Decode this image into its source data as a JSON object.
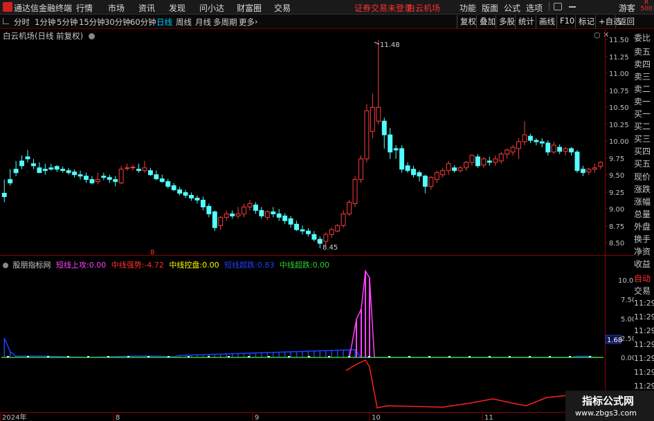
{
  "menubar": {
    "app_title": "通达信金融终端",
    "items": [
      "行情",
      "市场",
      "资讯",
      "发现",
      "问小达",
      "财富圈",
      "交易"
    ],
    "broker_status": "证券交易未登录",
    "stock_name": "白云机场",
    "right_items": [
      "功能",
      "版面",
      "公式",
      "选项"
    ],
    "guest": "游客",
    "badge_top": "R",
    "badge_bottom": "500"
  },
  "toolbar": {
    "periods": [
      "分时",
      "1分钟",
      "5分钟",
      "15分钟",
      "30分钟",
      "60分钟",
      "日线",
      "周线",
      "月线",
      "多周期",
      "更多"
    ],
    "active_period": "日线",
    "right_buttons": [
      "复权",
      "叠加",
      "多股",
      "统计",
      "画线",
      "F10",
      "标记",
      "+自选",
      "返回"
    ]
  },
  "main_chart": {
    "title": "白云机场(日线 前复权)",
    "high_label": "11.48",
    "low_label": "8.45",
    "y_ticks": [
      "11.50",
      "11.25",
      "11.00",
      "10.75",
      "10.50",
      "10.25",
      "10.00",
      "9.75",
      "9.50",
      "9.25",
      "9.00",
      "8.75",
      "8.50"
    ],
    "x_labels": [
      "2024年",
      "8",
      "9",
      "10",
      "11"
    ],
    "marker": "8"
  },
  "indicator": {
    "name": "股朋指标网",
    "fields": [
      {
        "label": "短线上攻:",
        "value": "0.00",
        "color": "#ff40ff"
      },
      {
        "label": "中线强势:",
        "value": "-4.72",
        "color": "#ff3030"
      },
      {
        "label": "中线控盘:",
        "value": "0.00",
        "color": "#ffff00"
      },
      {
        "label": "短线超跌:",
        "value": "0.83",
        "color": "#2040ff"
      },
      {
        "label": "中线超跌:",
        "value": "0.00",
        "color": "#30d030"
      }
    ],
    "y_ticks": [
      "10.00",
      "7.50",
      "5.00",
      "2.50",
      "0.00"
    ],
    "current_value": "1.68"
  },
  "sidebar": {
    "items": [
      "委比",
      "卖五",
      "卖四",
      "卖三",
      "卖二",
      "卖一",
      "买一",
      "买二",
      "买三",
      "买四",
      "买五",
      "现价",
      "涨跌",
      "涨幅",
      "总量",
      "外盘",
      "换手",
      "净资",
      "收益"
    ],
    "auto": "自动",
    "trade": "交易",
    "times": [
      "11:29",
      "11:29",
      "11:29",
      "11:29",
      "11:29",
      "11:29",
      "11:29",
      "11:29",
      "11:29",
      "11:29",
      "11:29"
    ]
  },
  "watermark": {
    "line1": "指标公式网",
    "line2": "www.zbgs3.com"
  },
  "chart_data": {
    "type": "candlestick",
    "price_range": [
      8.35,
      11.65
    ],
    "candles": [
      [
        9.25,
        9.45,
        9.2,
        9.12
      ],
      [
        9.45,
        9.6,
        9.4,
        9.36
      ],
      [
        9.6,
        9.72,
        9.55,
        9.5
      ],
      [
        9.72,
        9.8,
        9.65,
        9.6
      ],
      [
        9.78,
        9.88,
        9.75,
        9.7
      ],
      [
        9.68,
        9.75,
        9.65,
        9.6
      ],
      [
        9.62,
        9.7,
        9.55,
        9.55
      ],
      [
        9.6,
        9.68,
        9.58,
        9.52
      ],
      [
        9.62,
        9.68,
        9.6,
        9.58
      ],
      [
        9.64,
        9.66,
        9.6,
        9.56
      ],
      [
        9.6,
        9.64,
        9.58,
        9.55
      ],
      [
        9.58,
        9.62,
        9.55,
        9.52
      ],
      [
        9.56,
        9.6,
        9.52,
        9.48
      ],
      [
        9.52,
        9.58,
        9.5,
        9.45
      ],
      [
        9.5,
        9.55,
        9.45,
        9.4
      ],
      [
        9.45,
        9.5,
        9.4,
        9.38
      ],
      [
        9.42,
        9.55,
        9.45,
        9.38
      ],
      [
        9.5,
        9.55,
        9.48,
        9.44
      ],
      [
        9.48,
        9.52,
        9.45,
        9.4
      ],
      [
        9.45,
        9.5,
        9.42,
        9.35
      ],
      [
        9.4,
        9.65,
        9.6,
        9.38
      ],
      [
        9.62,
        9.68,
        9.62,
        9.58
      ],
      [
        9.62,
        9.66,
        9.63,
        9.58
      ],
      [
        9.6,
        9.68,
        9.58,
        9.55
      ],
      [
        9.58,
        9.72,
        9.62,
        9.55
      ],
      [
        9.58,
        9.62,
        9.52,
        9.5
      ],
      [
        9.52,
        9.58,
        9.46,
        9.44
      ],
      [
        9.46,
        9.52,
        9.42,
        9.4
      ],
      [
        9.42,
        9.46,
        9.35,
        9.32
      ],
      [
        9.36,
        9.4,
        9.3,
        9.28
      ],
      [
        9.3,
        9.34,
        9.25,
        9.22
      ],
      [
        9.26,
        9.3,
        9.22,
        9.18
      ],
      [
        9.22,
        9.26,
        9.18,
        9.14
      ],
      [
        9.18,
        9.22,
        9.15,
        9.1
      ],
      [
        9.15,
        9.2,
        9.05,
        9.0
      ],
      [
        9.06,
        9.1,
        8.95,
        8.9
      ],
      [
        8.98,
        9.0,
        8.75,
        8.7
      ],
      [
        8.78,
        8.92,
        8.9,
        8.72
      ],
      [
        8.9,
        9.0,
        8.95,
        8.85
      ],
      [
        8.95,
        9.0,
        8.92,
        8.88
      ],
      [
        8.92,
        9.05,
        8.95,
        8.88
      ],
      [
        8.95,
        9.1,
        9.05,
        8.9
      ],
      [
        9.05,
        9.15,
        9.1,
        9.0
      ],
      [
        9.08,
        9.12,
        9.0,
        8.95
      ],
      [
        9.0,
        9.05,
        8.92,
        8.88
      ],
      [
        8.9,
        9.0,
        8.98,
        8.86
      ],
      [
        8.98,
        9.05,
        8.95,
        8.9
      ],
      [
        8.95,
        9.02,
        8.9,
        8.85
      ],
      [
        8.92,
        8.96,
        8.85,
        8.8
      ],
      [
        8.88,
        8.92,
        8.8,
        8.75
      ],
      [
        8.8,
        8.85,
        8.72,
        8.7
      ],
      [
        8.72,
        8.78,
        8.7,
        8.65
      ],
      [
        8.7,
        8.74,
        8.66,
        8.62
      ],
      [
        8.65,
        8.7,
        8.58,
        8.55
      ],
      [
        8.58,
        8.62,
        8.52,
        8.45
      ],
      [
        8.55,
        8.68,
        8.65,
        8.5
      ],
      [
        8.65,
        8.75,
        8.72,
        8.6
      ],
      [
        8.7,
        8.8,
        8.78,
        8.68
      ],
      [
        8.78,
        9.0,
        8.95,
        8.75
      ],
      [
        8.95,
        9.15,
        9.12,
        8.92
      ],
      [
        9.1,
        9.5,
        9.45,
        9.05
      ],
      [
        9.45,
        9.8,
        9.75,
        9.4
      ],
      [
        9.75,
        10.55,
        10.45,
        9.7
      ],
      [
        10.15,
        10.7,
        10.5,
        10.05
      ],
      [
        10.3,
        11.48,
        10.5,
        10.25
      ],
      [
        10.3,
        10.35,
        10.1,
        9.9
      ],
      [
        10.1,
        10.2,
        9.85,
        9.75
      ],
      [
        9.9,
        9.95,
        9.88,
        9.75
      ],
      [
        9.9,
        9.95,
        9.6,
        9.55
      ],
      [
        9.65,
        9.7,
        9.58,
        9.55
      ],
      [
        9.6,
        9.65,
        9.52,
        9.48
      ],
      [
        9.55,
        9.58,
        9.5,
        9.42
      ],
      [
        9.5,
        9.52,
        9.35,
        9.25
      ],
      [
        9.35,
        9.5,
        9.48,
        9.3
      ],
      [
        9.45,
        9.58,
        9.55,
        9.4
      ],
      [
        9.52,
        9.62,
        9.58,
        9.48
      ],
      [
        9.58,
        9.72,
        9.68,
        9.52
      ],
      [
        9.62,
        9.66,
        9.58,
        9.55
      ],
      [
        9.58,
        9.65,
        9.62,
        9.55
      ],
      [
        9.62,
        9.72,
        9.7,
        9.58
      ],
      [
        9.7,
        9.82,
        9.8,
        9.65
      ],
      [
        9.78,
        9.82,
        9.65,
        9.62
      ],
      [
        9.66,
        9.78,
        9.75,
        9.62
      ],
      [
        9.72,
        9.78,
        9.7,
        9.65
      ],
      [
        9.7,
        9.8,
        9.75,
        9.65
      ],
      [
        9.72,
        9.85,
        9.82,
        9.68
      ],
      [
        9.82,
        9.9,
        9.88,
        9.75
      ],
      [
        9.85,
        9.95,
        9.92,
        9.8
      ],
      [
        9.9,
        10.05,
        10.0,
        9.75
      ],
      [
        10.0,
        10.3,
        10.1,
        9.95
      ],
      [
        10.08,
        10.12,
        10.02,
        9.98
      ],
      [
        10.02,
        10.05,
        10.0,
        9.95
      ],
      [
        10.0,
        10.05,
        9.98,
        9.92
      ],
      [
        9.98,
        10.02,
        9.85,
        9.8
      ],
      [
        9.85,
        10.0,
        9.95,
        9.82
      ],
      [
        9.92,
        9.96,
        9.86,
        9.82
      ],
      [
        9.86,
        9.92,
        9.9,
        9.8
      ],
      [
        9.9,
        9.92,
        9.85,
        9.8
      ],
      [
        9.85,
        9.88,
        9.58,
        9.55
      ],
      [
        9.6,
        9.65,
        9.55,
        9.5
      ],
      [
        9.56,
        9.62,
        9.6,
        9.52
      ],
      [
        9.6,
        9.68,
        9.62,
        9.55
      ],
      [
        9.64,
        9.72,
        9.7,
        9.6
      ]
    ]
  }
}
